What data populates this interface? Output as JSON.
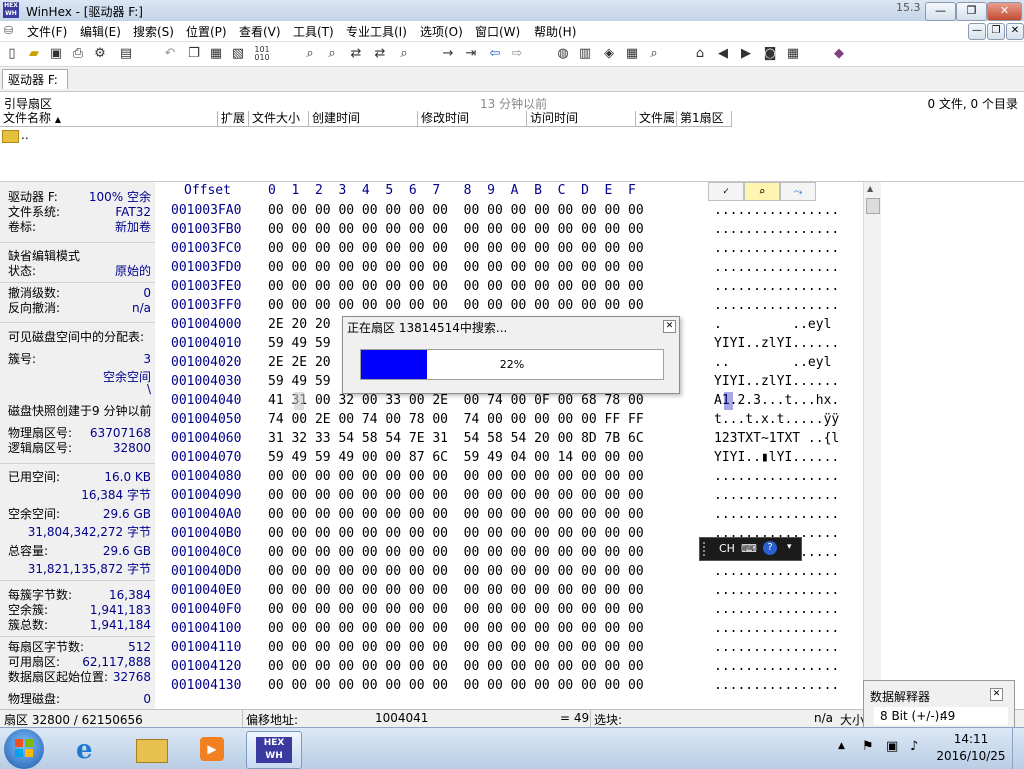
{
  "app": {
    "title": "WinHex - [驱动器 F:]",
    "version": "15.3",
    "window_buttons": [
      "—",
      "❐",
      "✕"
    ],
    "inner_buttons": [
      "—",
      "❐",
      "✕"
    ]
  },
  "menu": [
    "文件(F)",
    "编辑(E)",
    "搜索(S)",
    "位置(P)",
    "查看(V)",
    "工具(T)",
    "专业工具(I)",
    "选项(O)",
    "窗口(W)",
    "帮助(H)"
  ],
  "tab": {
    "label": "驱动器 F:"
  },
  "dirbar": {
    "path": "引导扇区",
    "time": "13 分钟以前",
    "count": "0 文件, 0 个目录"
  },
  "file_columns": [
    "文件名称",
    "扩展名",
    "文件大小",
    "创建时间",
    "修改时间",
    "访问时间",
    "文件属性",
    "第1扇区"
  ],
  "file_rows": [
    {
      "name": ".."
    }
  ],
  "left_panel": {
    "drive": "驱动器 F:",
    "free_pct": "100% 空余",
    "fs_label": "文件系统:",
    "fs": "FAT32",
    "vol_label": "卷标:",
    "vol": "新加卷",
    "mode_label": "缺省编辑模式",
    "state_label": "状态:",
    "state": "原始的",
    "undo_label": "撤消级数:",
    "undo": "0",
    "redo_label": "反向撤消:",
    "redo": "n/a",
    "alloc_label": "可见磁盘空间中的分配表:",
    "cluster_label": "簇号:",
    "cluster": "3",
    "cluster_status": "空余空间",
    "cluster_path": "\\",
    "snapshot": "磁盘快照创建于9 分钟以前",
    "phys_label": "物理扇区号:",
    "phys": "63707168",
    "logic_label": "逻辑扇区号:",
    "logic": "32800",
    "used_label": "已用空间:",
    "used": "16.0 KB",
    "used_bytes": "16,384 字节",
    "free_label": "空余空间:",
    "free": "29.6 GB",
    "free_bytes": "31,804,342,272 字节",
    "total_label": "总容量:",
    "total": "29.6 GB",
    "total_bytes": "31,821,135,872 字节",
    "bpc_label": "每簇字节数:",
    "bpc": "16,384",
    "fc_label": "空余簇:",
    "fc": "1,941,183",
    "tc_label": "簇总数:",
    "tc": "1,941,184",
    "bps_label": "每扇区字节数:",
    "bps": "512",
    "avail_label": "可用扇区:",
    "avail": "62,117,888",
    "start_label": "数据扇区起始位置:",
    "start": "32768",
    "physdisk_label": "物理磁盘:",
    "physdisk": "0"
  },
  "hex_header": {
    "offset": "Offset",
    "cols": "0  1  2  3  4  5  6  7   8  9  A  B  C  D  E  F"
  },
  "hex_rows": [
    {
      "o": "001003FA0",
      "h": "00 00 00 00 00 00 00 00  00 00 00 00 00 00 00 00",
      "t": "................"
    },
    {
      "o": "001003FB0",
      "h": "00 00 00 00 00 00 00 00  00 00 00 00 00 00 00 00",
      "t": "................"
    },
    {
      "o": "001003FC0",
      "h": "00 00 00 00 00 00 00 00  00 00 00 00 00 00 00 00",
      "t": "................"
    },
    {
      "o": "001003FD0",
      "h": "00 00 00 00 00 00 00 00  00 00 00 00 00 00 00 00",
      "t": "................"
    },
    {
      "o": "001003FE0",
      "h": "00 00 00 00 00 00 00 00  00 00 00 00 00 00 00 00",
      "t": "................"
    },
    {
      "o": "001003FF0",
      "h": "00 00 00 00 00 00 00 00  00 00 00 00 00 00 00 00",
      "t": "................"
    },
    {
      "o": "001004000",
      "h": "2E 20 20                                     6C",
      "t": ".         ..eyl"
    },
    {
      "o": "001004010",
      "h": "59 49 59                                     00",
      "t": "YIYI..zlYI......"
    },
    {
      "o": "001004020",
      "h": "2E 2E 20                                     6C",
      "t": "..        ..eyl"
    },
    {
      "o": "001004030",
      "h": "59 49 59                                     00",
      "t": "YIYI..zlYI......"
    },
    {
      "o": "001004040",
      "h": "41 31 00 32 00 33 00 2E  00 74 00 0F 00 68 78 00",
      "t": "A1.2.3...t...hx."
    },
    {
      "o": "001004050",
      "h": "74 00 2E 00 74 00 78 00  74 00 00 00 00 00 FF FF",
      "t": "t...t.x.t.....ÿÿ"
    },
    {
      "o": "001004060",
      "h": "31 32 33 54 58 54 7E 31  54 58 54 20 00 8D 7B 6C",
      "t": "123TXT~1TXT ..{l"
    },
    {
      "o": "001004070",
      "h": "59 49 59 49 00 00 87 6C  59 49 04 00 14 00 00 00",
      "t": "YIYI..▮lYI......"
    },
    {
      "o": "001004080",
      "h": "00 00 00 00 00 00 00 00  00 00 00 00 00 00 00 00",
      "t": "................"
    },
    {
      "o": "001004090",
      "h": "00 00 00 00 00 00 00 00  00 00 00 00 00 00 00 00",
      "t": "................"
    },
    {
      "o": "0010040A0",
      "h": "00 00 00 00 00 00 00 00  00 00 00 00 00 00 00 00",
      "t": "................"
    },
    {
      "o": "0010040B0",
      "h": "00 00 00 00 00 00 00 00  00 00 00 00 00 00 00 00",
      "t": "................"
    },
    {
      "o": "0010040C0",
      "h": "00 00 00 00 00 00 00 00  00 00 00 00 00 00 00 00",
      "t": "................"
    },
    {
      "o": "0010040D0",
      "h": "00 00 00 00 00 00 00 00  00 00 00 00 00 00 00 00",
      "t": "................"
    },
    {
      "o": "0010040E0",
      "h": "00 00 00 00 00 00 00 00  00 00 00 00 00 00 00 00",
      "t": "................"
    },
    {
      "o": "0010040F0",
      "h": "00 00 00 00 00 00 00 00  00 00 00 00 00 00 00 00",
      "t": "................"
    },
    {
      "o": "001004100",
      "h": "00 00 00 00 00 00 00 00  00 00 00 00 00 00 00 00",
      "t": "................"
    },
    {
      "o": "001004110",
      "h": "00 00 00 00 00 00 00 00  00 00 00 00 00 00 00 00",
      "t": "................"
    },
    {
      "o": "001004120",
      "h": "00 00 00 00 00 00 00 00  00 00 00 00 00 00 00 00",
      "t": "................"
    },
    {
      "o": "001004130",
      "h": "00 00 00 00 00 00 00 00  00 00 00 00 00 00 00 00",
      "t": "................"
    }
  ],
  "status": {
    "sector": "扇区 32800 / 62150656",
    "offset_label": "偏移地址:",
    "offset": "1004041",
    "value": "= 49",
    "sel_label": "选块:",
    "na": "n/a",
    "size_label": "大小"
  },
  "dialog": {
    "title": "正在扇区 13814514中搜索...",
    "progress_text": "22%",
    "progress": 0.22
  },
  "ime": {
    "lang": "CH"
  },
  "data_interpreter": {
    "title": "数据解释器",
    "row_label": "8 Bit (+/-):",
    "row_value": "49"
  },
  "clock": {
    "time": "14:11",
    "date": "2016/10/25"
  },
  "colors": {
    "accent": "#00008b",
    "progress": "#0000ff"
  }
}
